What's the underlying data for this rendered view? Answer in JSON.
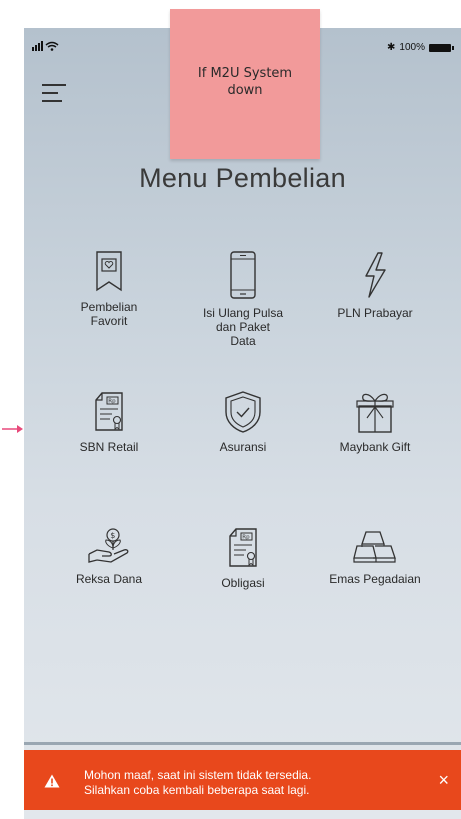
{
  "status": {
    "battery": "100%"
  },
  "sticky_note": {
    "line1": "If M2U System",
    "line2": "down"
  },
  "page_title": "Menu Pembelian",
  "menu": [
    {
      "icon": "bookmark-heart-icon",
      "label_lines": [
        "Pembelian",
        "Favorit"
      ]
    },
    {
      "icon": "smartphone-icon",
      "label_lines": [
        "Isi Ulang Pulsa",
        "dan Paket",
        "Data"
      ]
    },
    {
      "icon": "lightning-icon",
      "label_lines": [
        "PLN Prabayar"
      ]
    },
    {
      "icon": "certificate-rp-icon",
      "label_lines": [
        "SBN Retail"
      ]
    },
    {
      "icon": "shield-check-icon",
      "label_lines": [
        "Asuransi"
      ]
    },
    {
      "icon": "gift-icon",
      "label_lines": [
        "Maybank Gift"
      ]
    },
    {
      "icon": "hand-money-plant-icon",
      "label_lines": [
        "Reksa Dana"
      ]
    },
    {
      "icon": "certificate-rp-icon",
      "label_lines": [
        "Obligasi"
      ]
    },
    {
      "icon": "gold-bars-icon",
      "label_lines": [
        "Emas Pegadaian"
      ]
    }
  ],
  "toast": {
    "line1": "Mohon maaf, saat ini sistem tidak tersedia.",
    "line2": "Silahkan coba kembali beberapa saat lagi.",
    "close_label": "×"
  },
  "colors": {
    "toast_bg": "#e8481c",
    "sticky_bg": "#f29a9a",
    "arrow": "#e8487a"
  }
}
